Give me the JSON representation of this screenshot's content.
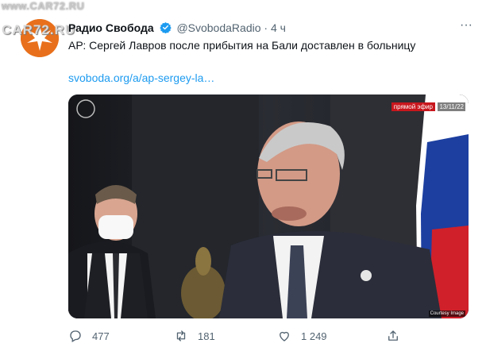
{
  "watermark": "www.CAR72.RU",
  "avatar": {
    "logo_text": "CAR72.RU",
    "brand_color": "#e8701c"
  },
  "tweet": {
    "author_name": "Радио Свобода",
    "handle": "@SvobodaRadio",
    "separator": "·",
    "time": "4 ч",
    "text": "АР: Сергей Лавров после прибытия на Бали доставлен в больницу",
    "link": "svoboda.org/a/ap-sergey-la…",
    "more_icon": "more-dots-icon"
  },
  "media": {
    "live_label": "прямой эфир",
    "date": "13/11/22",
    "credit": "Courtesy Image"
  },
  "actions": {
    "replies": "477",
    "retweets": "181",
    "likes": "1 249"
  },
  "colors": {
    "link": "#1d9bf0",
    "verified": "#1d9bf0",
    "muted": "#536471"
  }
}
